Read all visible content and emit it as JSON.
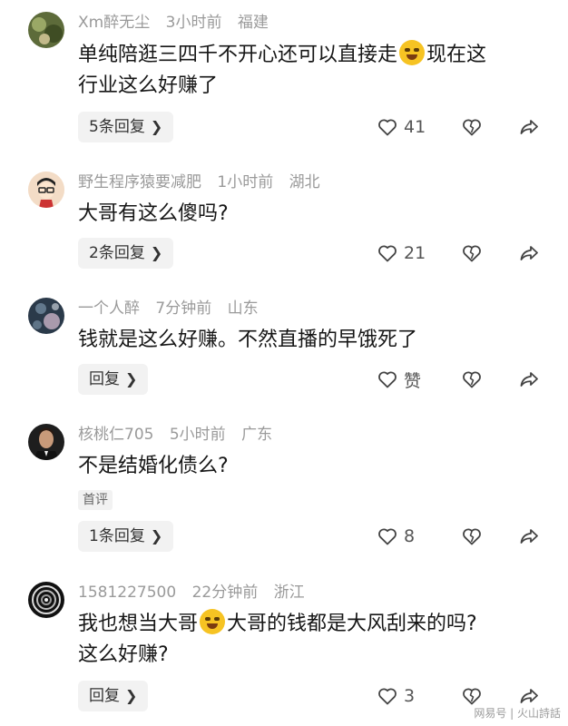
{
  "comments": [
    {
      "username": "Xm醉无尘",
      "time": "3小时前",
      "location": "福建",
      "text_line1_a": "单纯陪逛三四千不开心还可以直接走",
      "text_line1_b": "现在这",
      "text_line2": "行业这么好赚了",
      "reply_label": "5条回复",
      "like_count": "41"
    },
    {
      "username": "野生程序猿要减肥",
      "time": "1小时前",
      "location": "湖北",
      "text_line1": "大哥有这么傻吗?",
      "reply_label": "2条回复",
      "like_count": "21"
    },
    {
      "username": "一个人醉",
      "time": "7分钟前",
      "location": "山东",
      "text_line1": "钱就是这么好赚。不然直播的早饿死了",
      "reply_label": "回复",
      "like_count": "赞"
    },
    {
      "username": "核桃仁705",
      "time": "5小时前",
      "location": "广东",
      "text_line1": "不是结婚化债么?",
      "badge": "首评",
      "reply_label": "1条回复",
      "like_count": "8"
    },
    {
      "username": "1581227500",
      "time": "22分钟前",
      "location": "浙江",
      "text_line1_a": "我也想当大哥",
      "text_line1_b": "大哥的钱都是大风刮来的吗?",
      "text_line2": "这么好赚?",
      "reply_label": "回复",
      "like_count": "3"
    }
  ],
  "icons": {
    "like": "heart-icon",
    "dislike": "broken-heart-icon",
    "share": "share-arrow-icon",
    "reply_chevron": "chevron-right-icon",
    "emoji": "laughing-crying-emoji-icon"
  },
  "watermark": "网易号 | 火山詩話"
}
